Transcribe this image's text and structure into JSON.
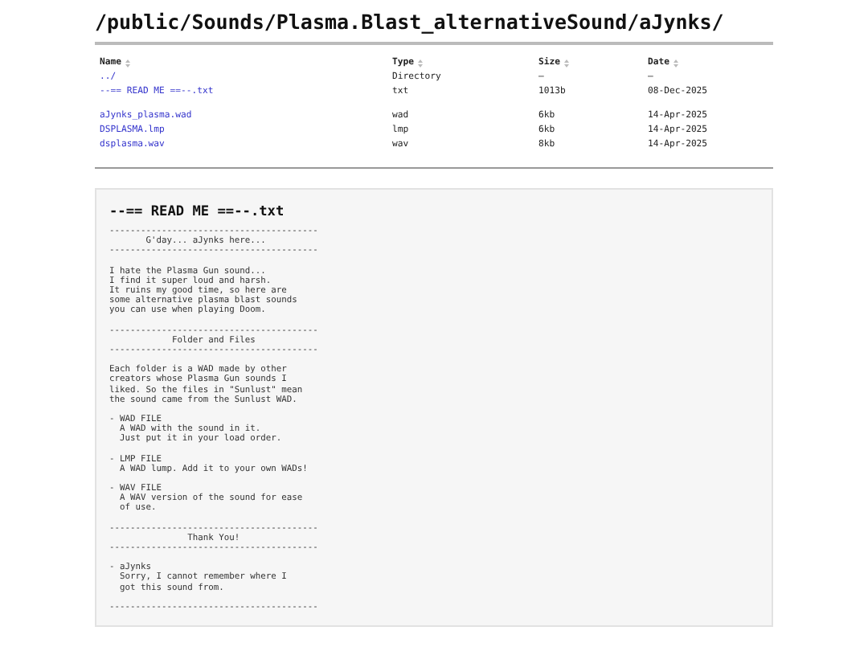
{
  "title": "/public/Sounds/Plasma.Blast_alternativeSound/aJynks/",
  "table": {
    "columns": [
      "Name",
      "Type",
      "Size",
      "Date"
    ],
    "row_groups": [
      [
        {
          "name": "../",
          "type": "Directory",
          "size": "—",
          "date": "—"
        },
        {
          "name": "--== READ ME ==--.txt",
          "type": "txt",
          "size": "1013b",
          "date": "08-Dec-2025"
        }
      ],
      [
        {
          "name": "aJynks_plasma.wad",
          "type": "wad",
          "size": "6kb",
          "date": "14-Apr-2025"
        },
        {
          "name": "DSPLASMA.lmp",
          "type": "lmp",
          "size": "6kb",
          "date": "14-Apr-2025"
        },
        {
          "name": "dsplasma.wav",
          "type": "wav",
          "size": "8kb",
          "date": "14-Apr-2025"
        }
      ]
    ]
  },
  "readme": {
    "title": "--== READ ME ==--.txt",
    "body": "----------------------------------------\n       G'day... aJynks here...\n----------------------------------------\n\nI hate the Plasma Gun sound...\nI find it super loud and harsh.\nIt ruins my good time, so here are\nsome alternative plasma blast sounds\nyou can use when playing Doom.\n\n----------------------------------------\n            Folder and Files\n----------------------------------------\n\nEach folder is a WAD made by other\ncreators whose Plasma Gun sounds I\nliked. So the files in \"Sunlust\" mean\nthe sound came from the Sunlust WAD.\n\n- WAD FILE\n  A WAD with the sound in it.\n  Just put it in your load order.\n\n- LMP FILE\n  A WAD lump. Add it to your own WADs!\n\n- WAV FILE\n  A WAV version of the sound for ease\n  of use.\n\n----------------------------------------\n               Thank You!\n----------------------------------------\n\n- aJynks\n  Sorry, I cannot remember where I\n  got this sound from.\n\n----------------------------------------"
  }
}
